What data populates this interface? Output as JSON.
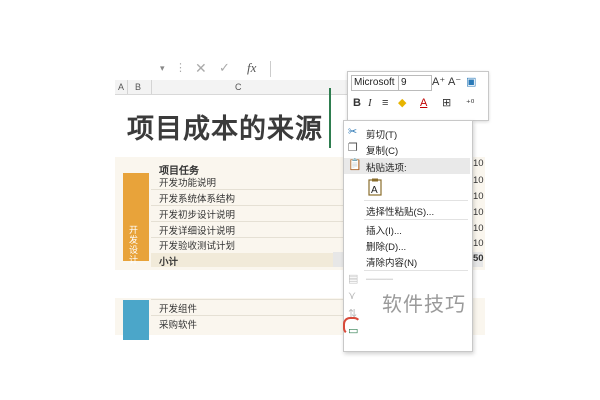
{
  "formula_bar": {
    "fx": "fx"
  },
  "columns": [
    "A",
    "B",
    "C"
  ],
  "sheet": {
    "title": "项目成本的来源",
    "task_header": "项目任务",
    "tasks": [
      "开发功能说明",
      "开发系统体系结构",
      "开发初步设计说明",
      "开发详细设计说明",
      "开发验收测试计划"
    ],
    "group_label": "开发设计",
    "subtotal": "小计",
    "tasks2": [
      "开发组件",
      "采购软件"
    ],
    "values": [
      "10",
      "10",
      "10",
      "10",
      "10",
      "10"
    ],
    "subtotal_value": "50"
  },
  "mini_toolbar": {
    "font": "Microsoft",
    "size": "9",
    "bold": "B",
    "italic": "I",
    "font_color": "A"
  },
  "context_menu": {
    "items": [
      "剪切(T)",
      "复制(C)",
      "粘贴选项:",
      "选择性粘贴(S)...",
      "插入(I)...",
      "删除(D)...",
      "清除内容(N)"
    ]
  },
  "watermark": "软件技巧",
  "colors": {
    "orange": "#e8a33a",
    "blue": "#4ba6c9",
    "green": "#2e7d4f",
    "accent_red": "#d84a3a"
  }
}
